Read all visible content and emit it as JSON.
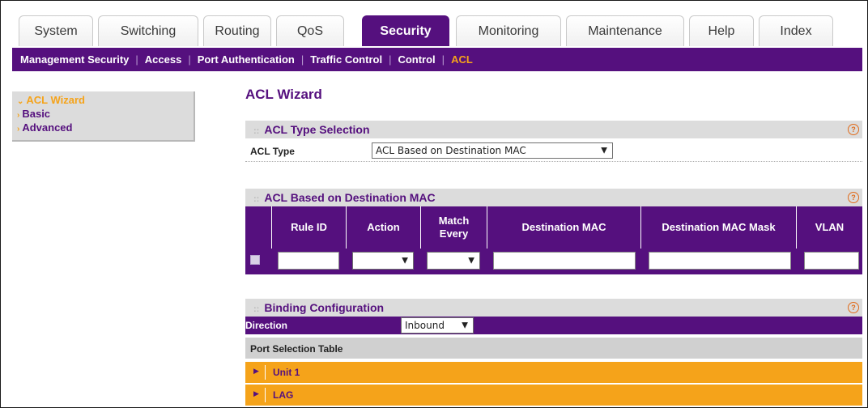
{
  "tabs": [
    {
      "label": "System"
    },
    {
      "label": "Switching"
    },
    {
      "label": "Routing"
    },
    {
      "label": "QoS"
    },
    {
      "label": "Security"
    },
    {
      "label": "Monitoring"
    },
    {
      "label": "Maintenance"
    },
    {
      "label": "Help"
    },
    {
      "label": "Index"
    }
  ],
  "subnav": [
    {
      "label": "Management Security"
    },
    {
      "label": "Access"
    },
    {
      "label": "Port Authentication"
    },
    {
      "label": "Traffic Control"
    },
    {
      "label": "Control"
    },
    {
      "label": "ACL"
    }
  ],
  "leftnav": [
    {
      "label": "ACL Wizard"
    },
    {
      "label": "Basic"
    },
    {
      "label": "Advanced"
    }
  ],
  "page_title": "ACL Wizard",
  "type_section": {
    "title": "ACL Type Selection",
    "label": "ACL Type",
    "value": "ACL Based on Destination MAC"
  },
  "mac_section": {
    "title": "ACL Based on Destination MAC",
    "columns": [
      "Rule ID",
      "Action",
      "Match Every",
      "Destination MAC",
      "Destination MAC Mask",
      "VLAN"
    ]
  },
  "binding": {
    "title": "Binding Configuration",
    "direction_label": "Direction",
    "direction_value": "Inbound",
    "port_table_title": "Port Selection Table",
    "rows": [
      "Unit 1",
      "LAG"
    ]
  },
  "help_glyph": "?",
  "colors": {
    "purple": "#55107e",
    "orange": "#f5a31a",
    "gray": "#dcdcdc"
  }
}
